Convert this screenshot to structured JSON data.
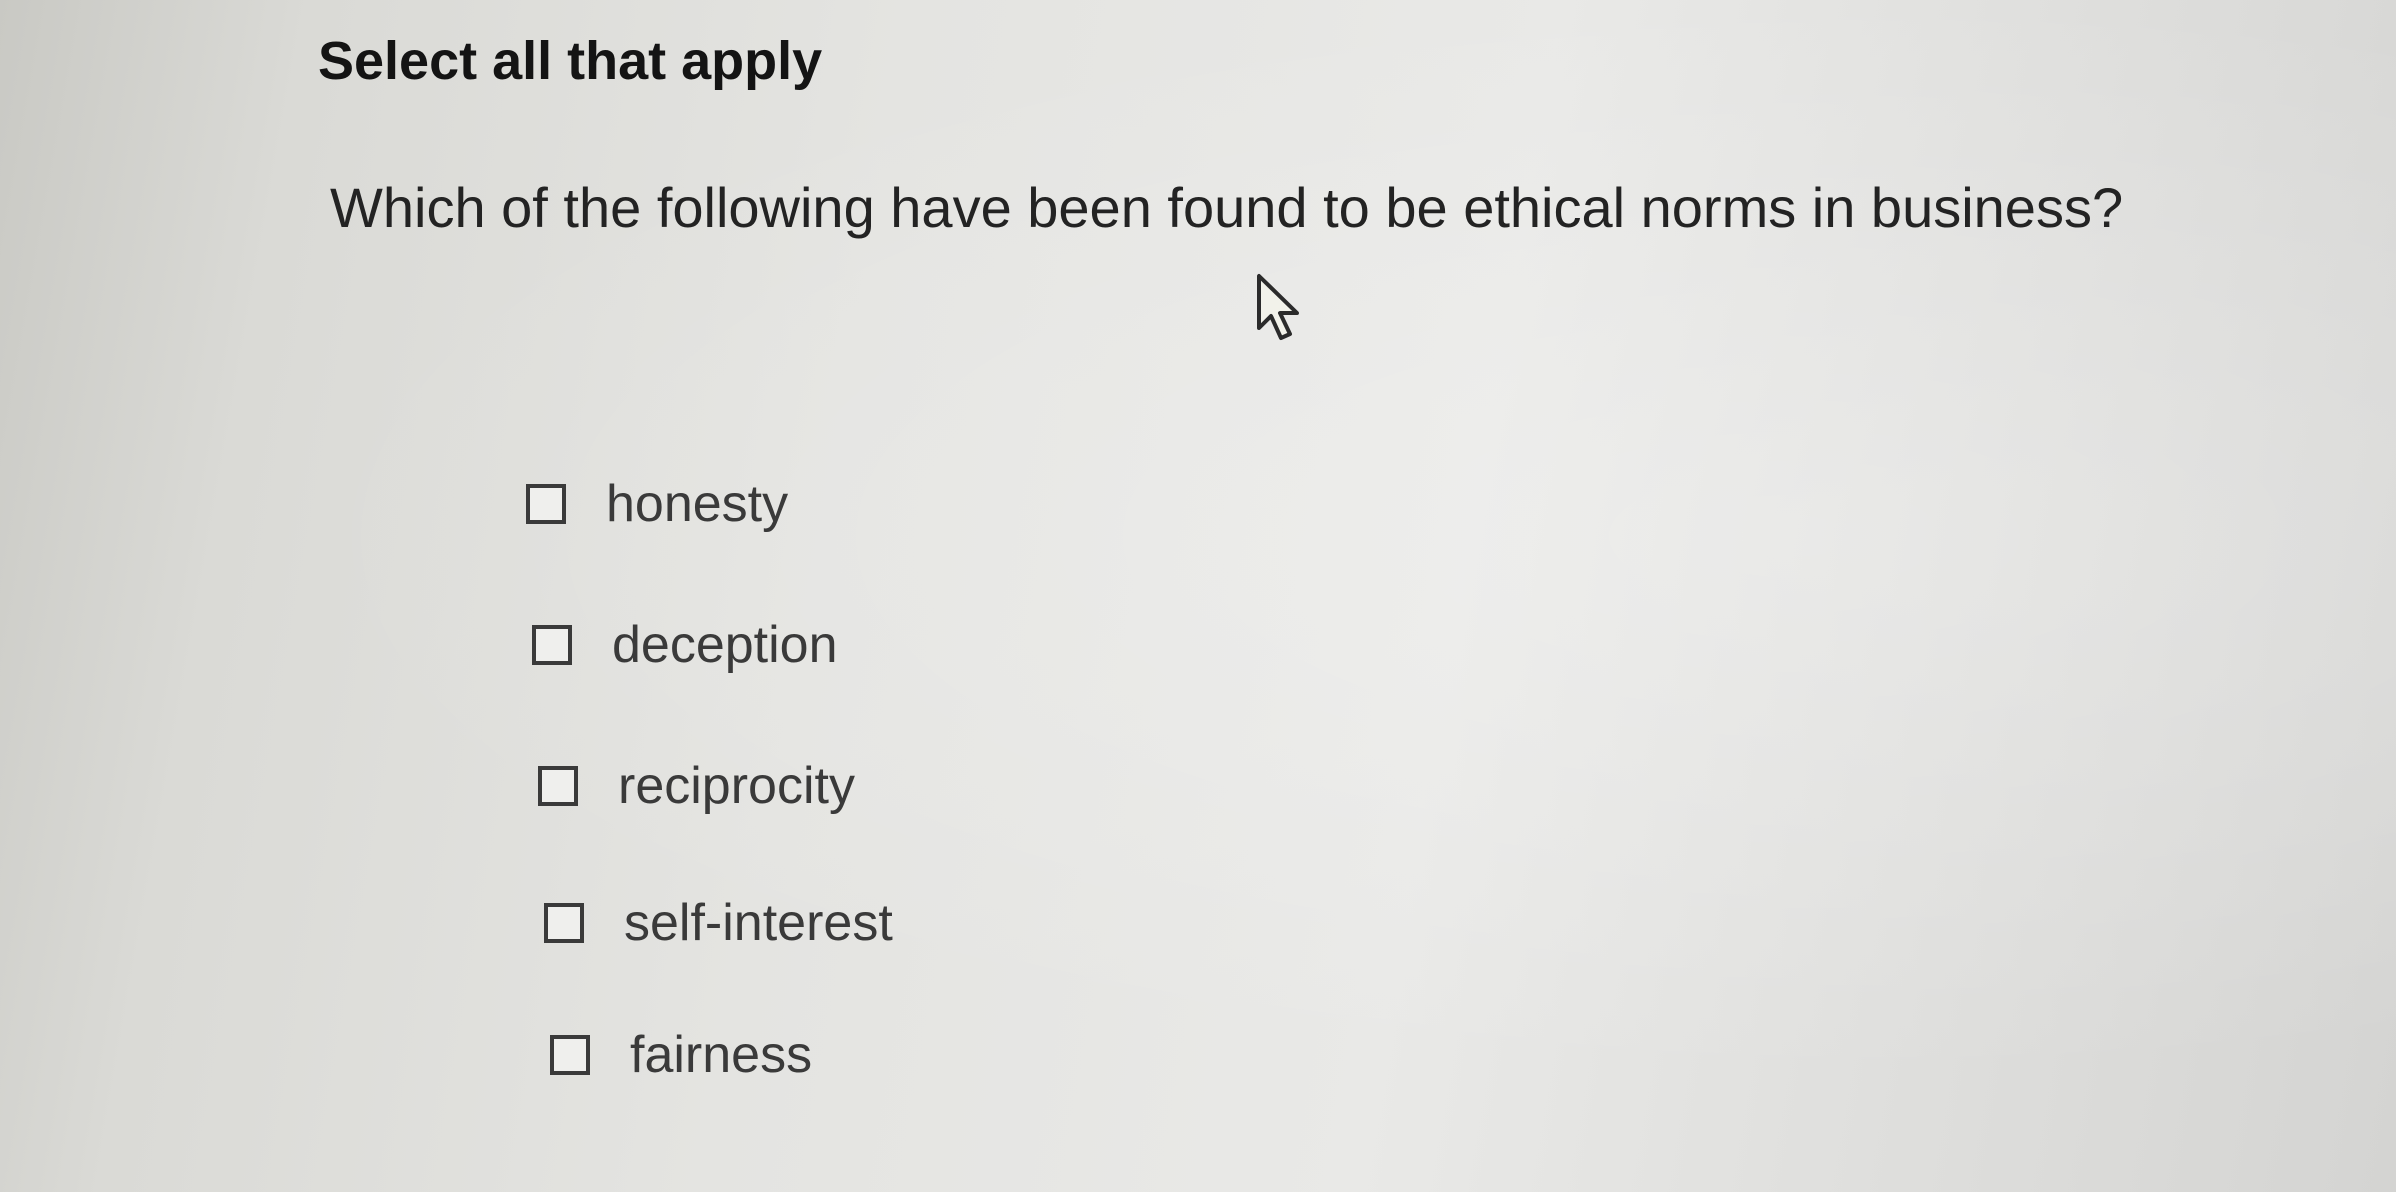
{
  "question": {
    "instruction": "Select all that apply",
    "prompt": "Which of the following have been found to be ethical norms in business?"
  },
  "options": [
    {
      "label": "honesty",
      "checked": false
    },
    {
      "label": "deception",
      "checked": false
    },
    {
      "label": "reciprocity",
      "checked": false
    },
    {
      "label": "self-interest",
      "checked": false
    },
    {
      "label": "fairness",
      "checked": false
    }
  ],
  "cursor": {
    "icon": "mouse-pointer-icon"
  }
}
